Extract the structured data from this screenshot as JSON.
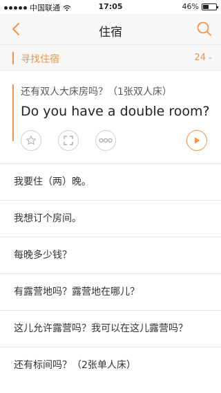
{
  "status": {
    "carrier": "中国联通",
    "time": "17:05",
    "battery": "46%",
    "battery_level": 0.46
  },
  "nav": {
    "title": "住宿"
  },
  "category": {
    "title": "寻找住宿",
    "count": "24"
  },
  "featured": {
    "zh": "还有双人大床房吗？（1张双人床）",
    "en": "Do you have a double room?"
  },
  "phrases": [
    "我要住（两）晚。",
    "我想订个房间。",
    "每晚多少钱？",
    "有露营地吗？露营地在哪儿？",
    "这儿允许露营吗？我可以在这儿露营吗？",
    "还有标间吗？（2张单人床）"
  ],
  "colors": {
    "accent": "#f29345"
  }
}
